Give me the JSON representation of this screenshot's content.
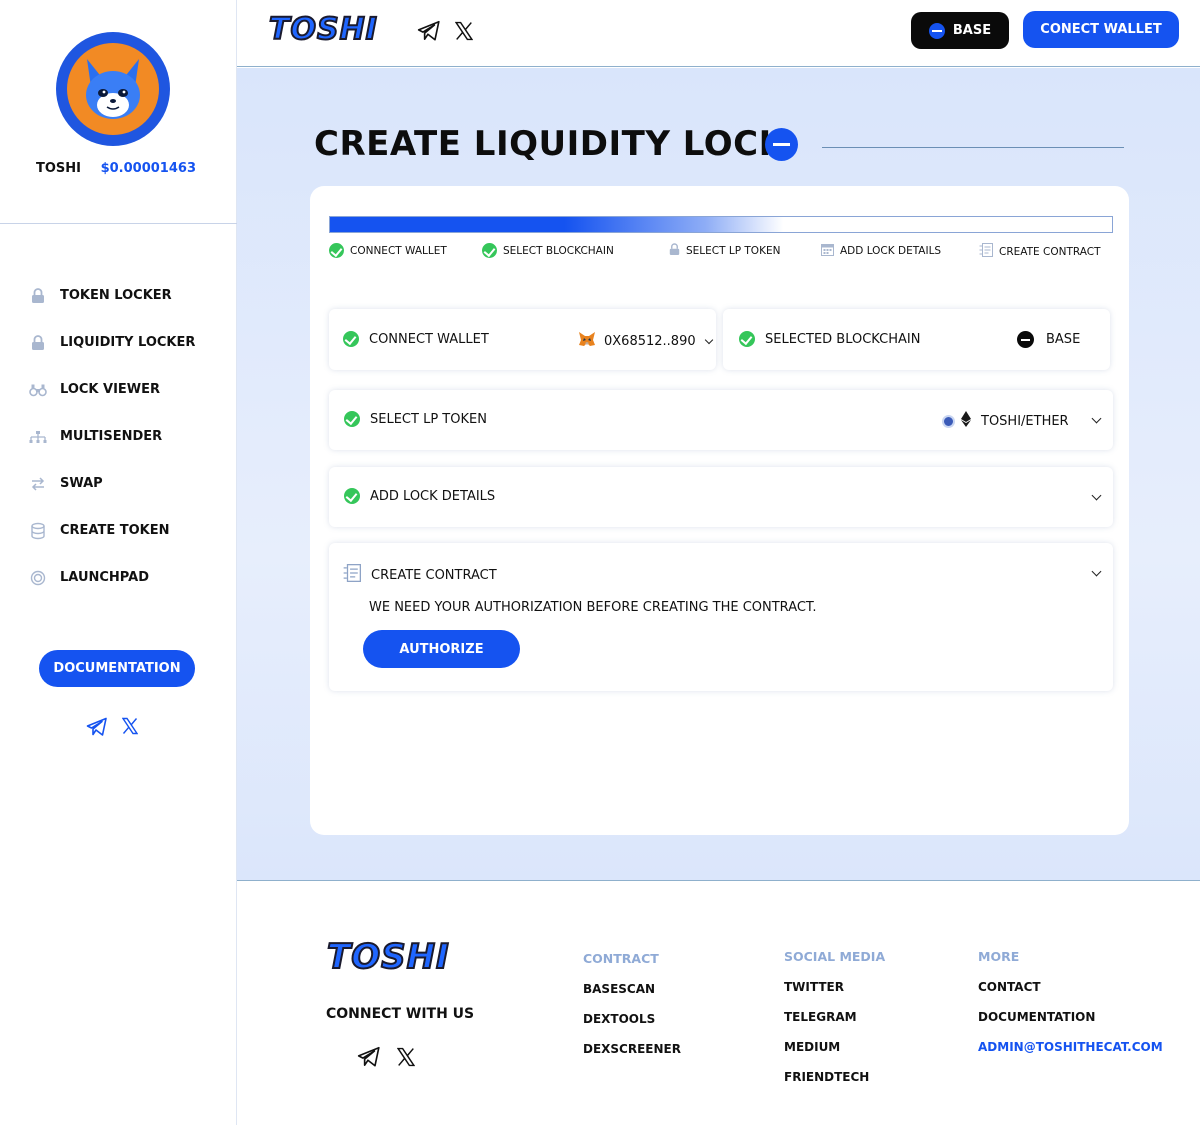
{
  "brand": {
    "logo_text": "TOSHI"
  },
  "sidebar": {
    "token_name": "TOSHI",
    "token_price": "$0.00001463",
    "items": [
      {
        "label": "TOKEN LOCKER",
        "icon": "lock-icon"
      },
      {
        "label": "LIQUIDITY LOCKER",
        "icon": "lock-icon"
      },
      {
        "label": "LOCK VIEWER",
        "icon": "binoculars-icon"
      },
      {
        "label": "MULTISENDER",
        "icon": "hierarchy-icon"
      },
      {
        "label": "SWAP",
        "icon": "swap-icon"
      },
      {
        "label": "CREATE TOKEN",
        "icon": "coins-icon"
      },
      {
        "label": "LAUNCHPAD",
        "icon": "rocket-icon"
      }
    ],
    "documentation_label": "DOCUMENTATION"
  },
  "header": {
    "network_label": "BASE",
    "connect_label": "CONECT WALLET"
  },
  "main": {
    "title": "CREATE LIQUIDITY LOCK",
    "progress_fraction": 0.55,
    "steps": [
      {
        "label": "CONNECT WALLET",
        "state": "done"
      },
      {
        "label": "SELECT BLOCKCHAIN",
        "state": "done"
      },
      {
        "label": "SELECT LP TOKEN",
        "state": "lock"
      },
      {
        "label": "ADD LOCK DETAILS",
        "state": "calendar"
      },
      {
        "label": "CREATE CONTRACT",
        "state": "contract"
      }
    ],
    "wallet_panel": {
      "label": "CONNECT WALLET",
      "address": "0X68512..890"
    },
    "chain_panel": {
      "label": "SELECTED BLOCKCHAIN",
      "value": "BASE"
    },
    "lp_panel": {
      "label": "SELECT LP TOKEN",
      "value": "TOSHI/ETHER"
    },
    "lock_panel": {
      "label": "ADD LOCK DETAILS"
    },
    "contract_panel": {
      "label": "CREATE CONTRACT",
      "message": "WE NEED YOUR AUTHORIZATION BEFORE CREATING THE CONTRACT.",
      "button": "AUTHORIZE"
    }
  },
  "footer": {
    "connect_with": "CONNECT WITH US",
    "contract": {
      "heading": "CONTRACT",
      "links": [
        "BASESCAN",
        "DEXTOOLS",
        "DEXSCREENER"
      ]
    },
    "social": {
      "heading": "SOCIAL MEDIA",
      "links": [
        "TWITTER",
        "TELEGRAM",
        "MEDIUM",
        "FRIENDTECH"
      ]
    },
    "more": {
      "heading": "MORE",
      "links": [
        "CONTACT",
        "DOCUMENTATION",
        "ADMIN@TOSHITHECAT.COM"
      ]
    }
  },
  "colors": {
    "accent": "#1553f0",
    "success": "#35c65a",
    "muted_heading": "#8faad6"
  }
}
